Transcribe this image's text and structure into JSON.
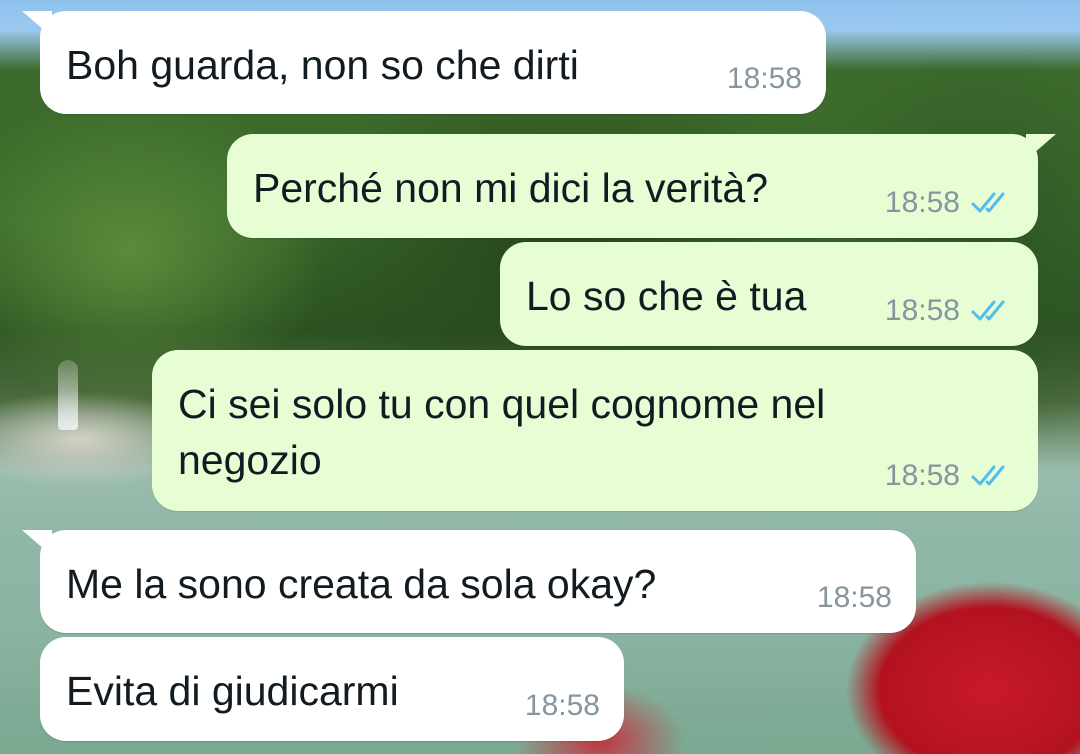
{
  "conversation": {
    "messages": [
      {
        "direction": "incoming",
        "text": "Boh guarda, non so che dirti",
        "time": "18:58",
        "status": ""
      },
      {
        "direction": "outgoing",
        "text": "Perché non mi dici la verità?",
        "time": "18:58",
        "status": "read"
      },
      {
        "direction": "outgoing",
        "text": "Lo so che è tua",
        "time": "18:58",
        "status": "read"
      },
      {
        "direction": "outgoing",
        "text": "Ci sei solo tu con quel cognome nel negozio",
        "time": "18:58",
        "status": "read"
      },
      {
        "direction": "incoming",
        "text": "Me la sono creata da sola okay?",
        "time": "18:58",
        "status": ""
      },
      {
        "direction": "incoming",
        "text": "Evita di giudicarmi",
        "time": "18:58",
        "status": ""
      }
    ]
  },
  "icons": {
    "read_receipt": "double-check-icon"
  },
  "colors": {
    "incoming_bubble": "#ffffff",
    "outgoing_bubble": "#e7fdd4",
    "timestamp": "#8696a0",
    "read_ticks": "#53bdeb"
  }
}
